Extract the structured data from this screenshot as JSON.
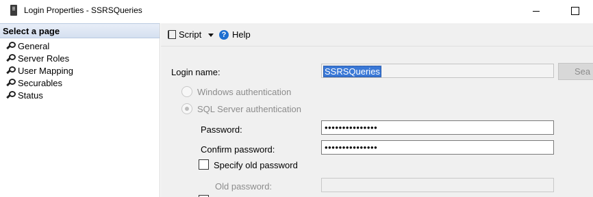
{
  "window": {
    "title": "Login Properties - SSRSQueries"
  },
  "sidebar": {
    "header": "Select a page",
    "items": [
      {
        "label": "General"
      },
      {
        "label": "Server Roles"
      },
      {
        "label": "User Mapping"
      },
      {
        "label": "Securables"
      },
      {
        "label": "Status"
      }
    ],
    "selected": "General"
  },
  "toolbar": {
    "script_label": "Script",
    "help_label": "Help"
  },
  "form": {
    "login_name_label": "Login name:",
    "login_name_value": "SSRSQueries",
    "search_button": "Sea",
    "windows_auth_label": "Windows authentication",
    "sql_auth_label": "SQL Server authentication",
    "sql_auth_selected": true,
    "password_label": "Password:",
    "password_value": "•••••••••••••••",
    "confirm_password_label": "Confirm password:",
    "confirm_password_value": "•••••••••••••••",
    "specify_old_password_label": "Specify old password",
    "specify_old_password_checked": false,
    "old_password_label": "Old password:",
    "old_password_value": ""
  },
  "icons": {
    "app": "server-icon",
    "page_item": "wrench-icon",
    "script": "script-icon",
    "help": "help-icon"
  }
}
